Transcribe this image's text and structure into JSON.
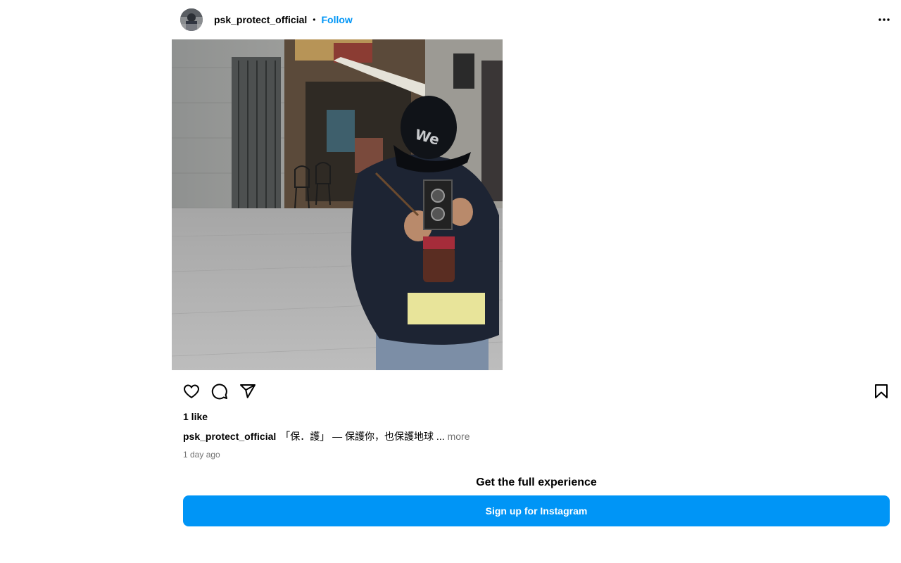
{
  "post": {
    "username": "psk_protect_official",
    "separator": "•",
    "follow_label": "Follow",
    "likes": "1 like",
    "caption_user": "psk_protect_official",
    "caption_text": "「保．護」 — 保護你，也保護地球 ...",
    "caption_more": "more",
    "time_ago": "1 day ago"
  },
  "icons": {
    "more": "more-options-icon",
    "like": "heart-icon",
    "comment": "comment-icon",
    "share": "share-icon",
    "save": "bookmark-icon"
  },
  "cta": {
    "title": "Get the full experience",
    "button_label": "Sign up for Instagram"
  },
  "colors": {
    "accent": "#0095f6",
    "secondary_text": "#737373"
  }
}
